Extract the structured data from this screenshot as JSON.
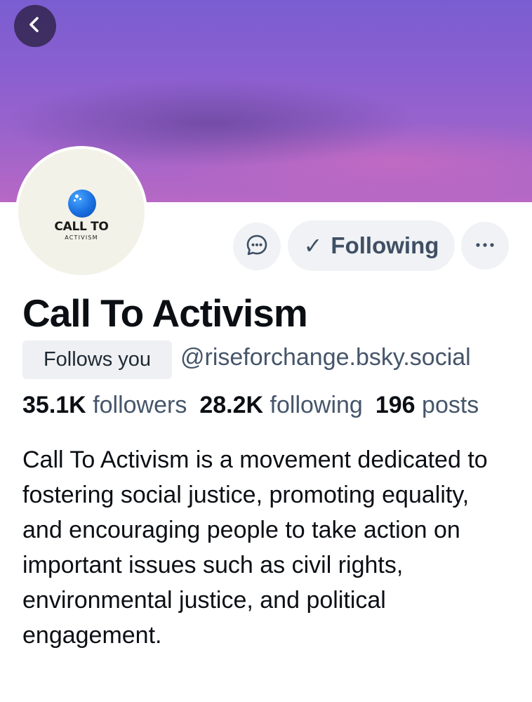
{
  "header": {
    "back_icon": "chevron-left-icon"
  },
  "avatar": {
    "logo_title": "CALL TO",
    "logo_subtitle": "ACTIVISM",
    "logo_color": "#1a6fe0"
  },
  "actions": {
    "message_icon": "chat-bubble-icon",
    "follow_check": "✓",
    "follow_label": "Following",
    "more_icon": "ellipsis-icon"
  },
  "profile": {
    "display_name": "Call To Activism",
    "follows_you": "Follows you",
    "handle": "@riseforchange.bsky.social",
    "followers_count": "35.1K",
    "followers_label": "followers",
    "following_count": "28.2K",
    "following_label": "following",
    "posts_count": "196",
    "posts_label": "posts",
    "bio": "Call To Activism is a movement dedicated to fostering social justice, promoting equality, and encouraging people to take action on important issues such as civil rights, environmental justice, and political engagement."
  },
  "colors": {
    "banner_top": "#7a5ed1",
    "banner_bottom": "#b768c4",
    "button_bg": "#f0f2f5",
    "muted_text": "#45556a"
  }
}
